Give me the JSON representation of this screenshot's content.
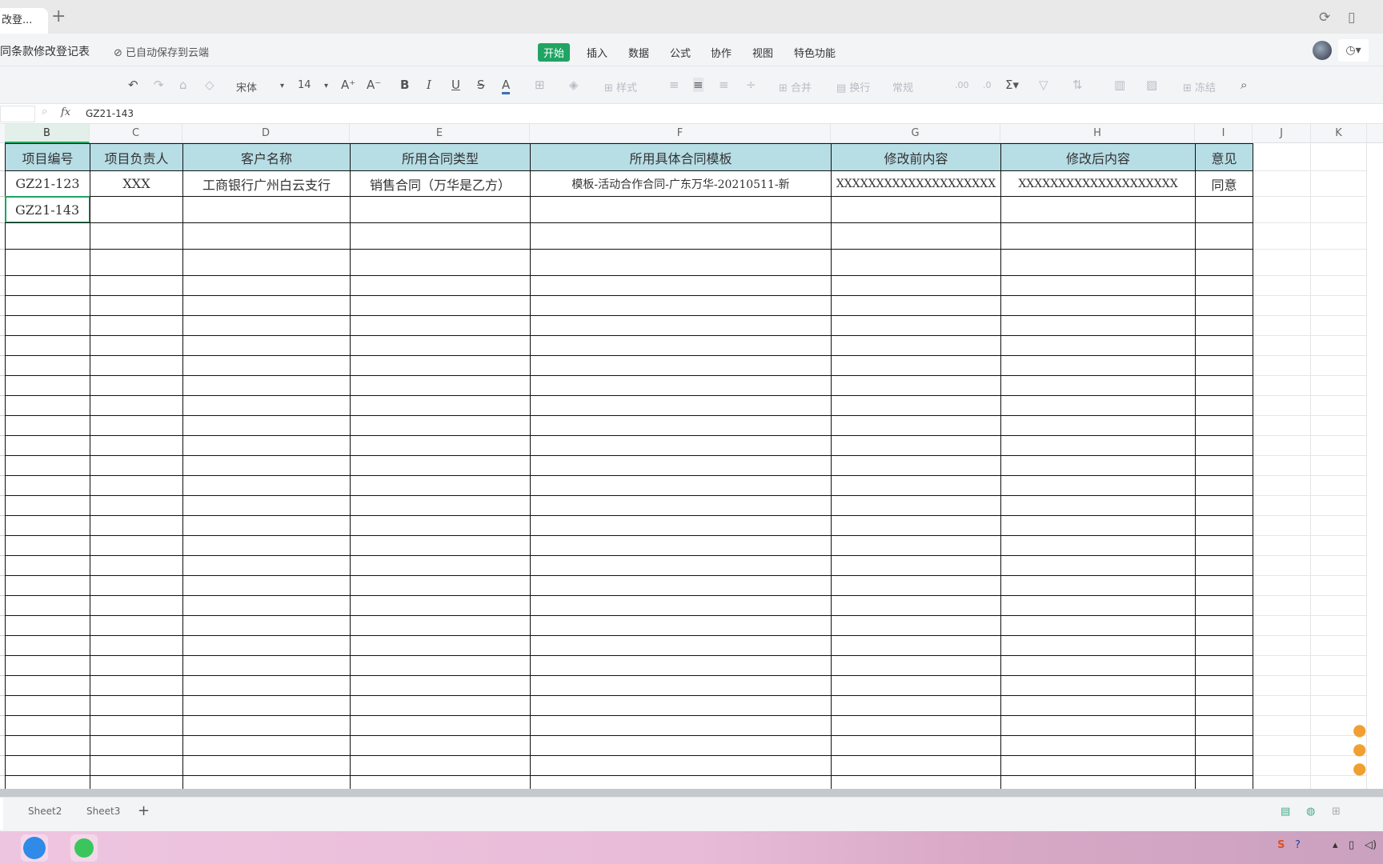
{
  "tabbar": {
    "doc_tab": "改登...",
    "new_tab": "+"
  },
  "titlebar": {
    "doc_title": "同条款修改登记表",
    "saved_status": "已自动保存到云端",
    "menus": [
      {
        "label": "开始",
        "active": true
      },
      {
        "label": "插入"
      },
      {
        "label": "数据"
      },
      {
        "label": "公式"
      },
      {
        "label": "协作"
      },
      {
        "label": "视图"
      },
      {
        "label": "特色功能"
      }
    ]
  },
  "toolbar": {
    "font": "宋体",
    "size": "14",
    "style": "样式",
    "merge": "合并",
    "wrap": "换行",
    "number_format": "常规",
    "freeze": "冻结"
  },
  "formula_bar": {
    "value": "GZ21-143"
  },
  "columns": [
    "B",
    "C",
    "D",
    "E",
    "F",
    "G",
    "H",
    "I",
    "J",
    "K"
  ],
  "selected_column": "B",
  "table": {
    "headers": [
      "项目编号",
      "项目负责人",
      "客户名称",
      "所用合同类型",
      "所用具体合同模板",
      "修改前内容",
      "修改后内容",
      "意见"
    ],
    "rows": [
      [
        "GZ21-123",
        "XXX",
        "工商银行广州白云支行",
        "销售合同（万华是乙方）",
        "模板-活动合作合同-广东万华-20210511-新",
        "XXXXXXXXXXXXXXXXXXXX",
        "XXXXXXXXXXXXXXXXXXXX",
        "同意"
      ],
      [
        "GZ21-143",
        "",
        "",
        "",
        "",
        "",
        "",
        ""
      ]
    ]
  },
  "sheets": [
    "Sheet2",
    "Sheet3"
  ],
  "colors": {
    "accent": "#1fa463",
    "header_fill": "#b7dde5"
  }
}
